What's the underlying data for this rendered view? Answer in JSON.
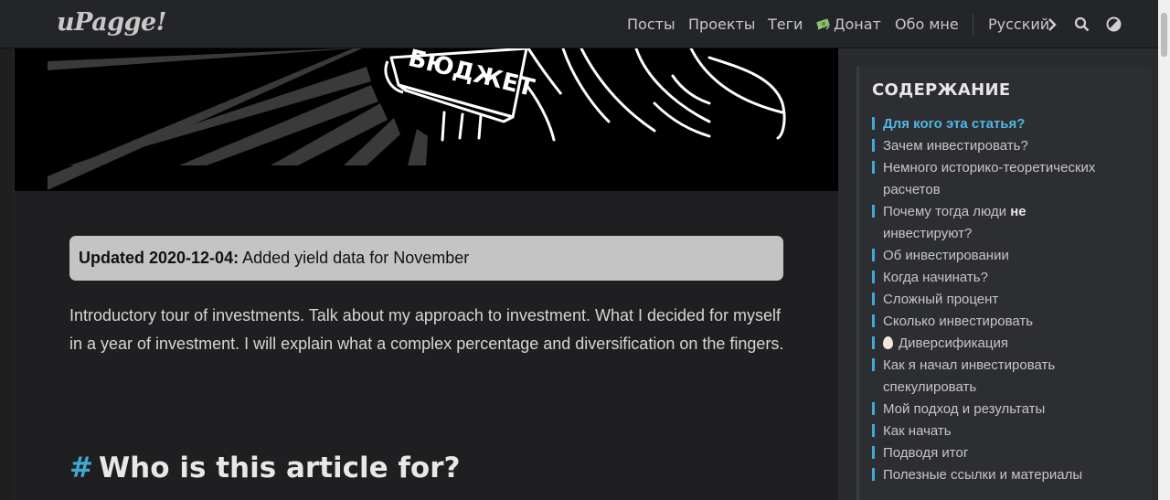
{
  "header": {
    "logo": "uPagge!",
    "nav": [
      "Посты",
      "Проекты",
      "Теги",
      "Донат",
      "Обо мне"
    ],
    "donate_icon": "money-icon",
    "language": "Русский",
    "search_icon": "search-icon",
    "theme_icon": "theme-toggle-icon"
  },
  "hero": {
    "sign_text": "БЮДЖЕТ"
  },
  "article": {
    "updated_label": "Updated 2020-12-04:",
    "updated_text": " Added yield data for November",
    "intro": "Introductory tour of investments. Talk about my approach to investment. What I decided for myself in a year of investment. I will explain what a complex percentage and diversification on the fingers.",
    "heading_hash": "#",
    "heading": "Who is this article for?"
  },
  "toc": {
    "title": "СОДЕРЖАНИЕ",
    "items": [
      {
        "label": "Для кого эта статья?"
      },
      {
        "label": "Зачем инвестировать?"
      },
      {
        "label_1": "Немного историко-теоретических",
        "label_2": "расчетов"
      },
      {
        "label_1": "Почему тогда люди ",
        "bold": "не",
        "label_2": "инвестируют?"
      },
      {
        "label": "Об инвестировании"
      },
      {
        "label": "Когда начинать?"
      },
      {
        "label": "Сложный процент"
      },
      {
        "label": "Сколько инвестировать"
      },
      {
        "label": "Диверсификация",
        "icon": "egg-icon"
      },
      {
        "label_1": "Как я начал инвестировать",
        "label_2": "спекулировать"
      },
      {
        "label": "Мой подход и результаты"
      },
      {
        "label": "Как начать"
      },
      {
        "label": "Подводя итог"
      },
      {
        "label": "Полезные ссылки и материалы"
      }
    ]
  },
  "colors": {
    "accent": "#3fa9d6",
    "background": "#1f1f21",
    "updated_box": "#c4c4c4"
  }
}
